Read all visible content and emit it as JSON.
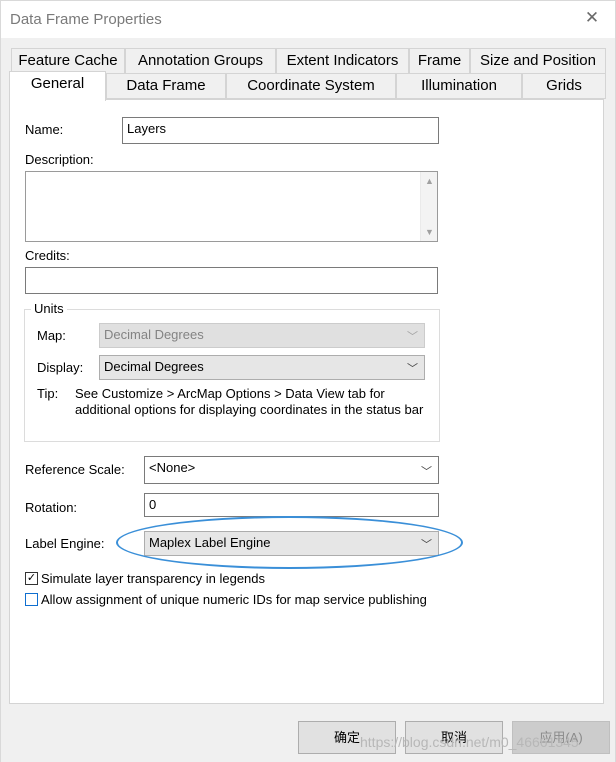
{
  "window": {
    "title": "Data Frame Properties",
    "close_glyph": "✕"
  },
  "tabs_back": [
    {
      "label": "Feature Cache"
    },
    {
      "label": "Annotation Groups"
    },
    {
      "label": "Extent Indicators"
    },
    {
      "label": "Frame"
    },
    {
      "label": "Size and Position"
    }
  ],
  "tabs_front": [
    {
      "label": "General",
      "active": true
    },
    {
      "label": "Data Frame"
    },
    {
      "label": "Coordinate System"
    },
    {
      "label": "Illumination"
    },
    {
      "label": "Grids"
    }
  ],
  "general": {
    "name_label": "Name:",
    "name_value": "Layers",
    "description_label": "Description:",
    "description_value": "",
    "credits_label": "Credits:",
    "credits_value": "",
    "units": {
      "title": "Units",
      "map_label": "Map:",
      "map_value": "Decimal Degrees",
      "display_label": "Display:",
      "display_value": "Decimal Degrees",
      "tip_label": "Tip:",
      "tip_line1": "See Customize > ArcMap Options > Data View tab for",
      "tip_line2": "additional options for displaying coordinates in the status bar"
    },
    "reference_scale_label": "Reference Scale:",
    "reference_scale_value": "<None>",
    "rotation_label": "Rotation:",
    "rotation_value": "0",
    "label_engine_label": "Label Engine:",
    "label_engine_value": "Maplex Label Engine",
    "simulate_transparency_label": "Simulate layer transparency in legends",
    "simulate_transparency_checked": true,
    "unique_ids_label": "Allow assignment of unique numeric IDs for map service publishing",
    "unique_ids_checked": false
  },
  "buttons": {
    "ok": "确定",
    "cancel": "取消",
    "apply": "应用(A)"
  },
  "watermark": "https://blog.csdn.net/m0_46661345"
}
